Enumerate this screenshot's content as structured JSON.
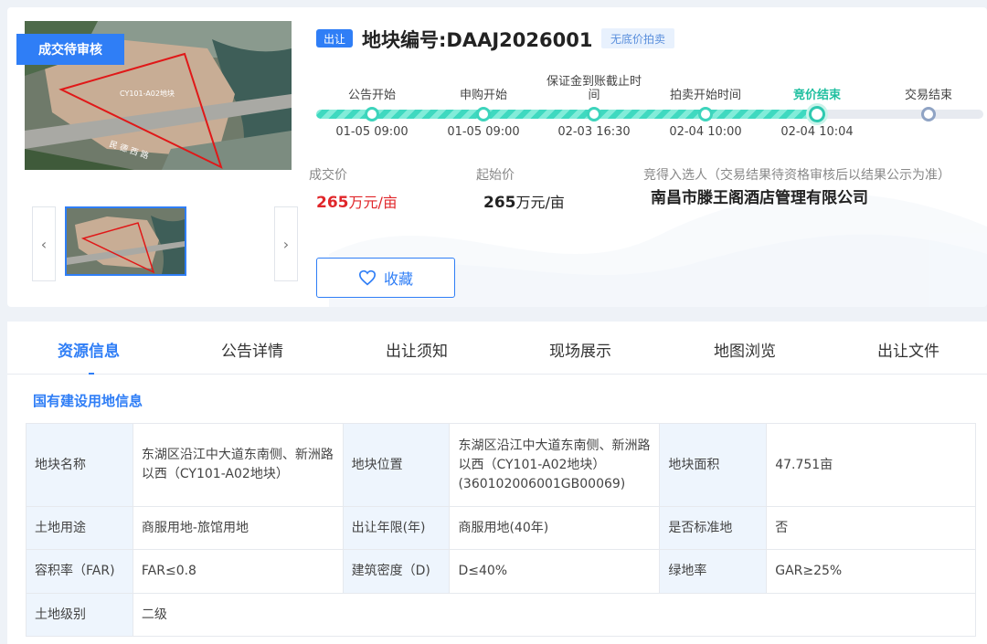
{
  "status_badge": "成交待审核",
  "tag_out": "出让",
  "parcel_title": "地块编号:DAAJ2026001",
  "tag_noreserve": "无底价拍卖",
  "photo": {
    "overlay_label": "CY101-A02地块",
    "road_label": "民 德 西 路"
  },
  "thumb_nav": {
    "prev": "‹",
    "next": "›"
  },
  "steps": [
    {
      "label": "公告开始",
      "time": "01-05 09:00"
    },
    {
      "label": "申购开始",
      "time": "01-05 09:00"
    },
    {
      "label": "保证金到账截止时间",
      "time": "02-03 16:30"
    },
    {
      "label": "拍卖开始时间",
      "time": "02-04 10:00"
    },
    {
      "label": "竞价结束",
      "time": "02-04 10:04"
    },
    {
      "label": "交易结束",
      "time": ""
    }
  ],
  "deal_price": {
    "label": "成交价",
    "value": "265",
    "unit": "万元/亩"
  },
  "start_price": {
    "label": "起始价",
    "value": "265",
    "unit": "万元/亩"
  },
  "winner": {
    "label": "竞得入选人（交易结果待资格审核后以结果公示为准）",
    "value": "南昌市滕王阁酒店管理有限公司"
  },
  "favorite_label": "收藏",
  "tabs": [
    "资源信息",
    "公告详情",
    "出让须知",
    "现场展示",
    "地图浏览",
    "出让文件"
  ],
  "section_title": "国有建设用地信息",
  "table": [
    [
      "地块名称",
      "东湖区沿江中大道东南侧、新洲路以西（CY101-A02地块）",
      "地块位置",
      "东湖区沿江中大道东南侧、新洲路以西（CY101-A02地块）(360102006001GB00069)",
      "地块面积",
      "47.751亩"
    ],
    [
      "土地用途",
      "商服用地-旅馆用地",
      "出让年限(年)",
      "商服用地(40年)",
      "是否标准地",
      "否"
    ],
    [
      "容积率（FAR)",
      "FAR≤0.8",
      "建筑密度（D)",
      "D≤40%",
      "绿地率",
      "GAR≥25%"
    ],
    [
      "土地级别",
      "二级"
    ]
  ],
  "colors": {
    "primary": "#2f7ef6",
    "price_red": "#e0262a",
    "progress": "#3fd9c0",
    "active_step": "#1fbf9f"
  }
}
